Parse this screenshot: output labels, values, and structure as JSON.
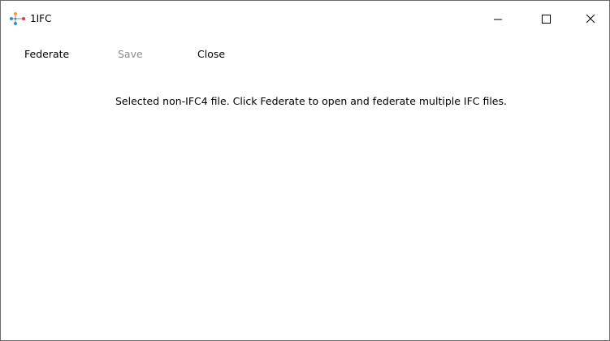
{
  "window": {
    "title": "1IFC",
    "app_icon": "federated-nodes-icon",
    "caption_buttons": {
      "minimize_icon": "minimize-icon",
      "maximize_icon": "maximize-icon",
      "close_icon": "close-icon"
    }
  },
  "menu": {
    "federate_label": "Federate",
    "save_label": "Save",
    "close_label": "Close"
  },
  "main": {
    "status_message": "Selected non-IFC4 file. Click Federate to open and federate multiple IFC files."
  },
  "colors": {
    "disabled_text": "#8c8c8c",
    "icon_node_blue": "#3a86d9",
    "icon_node_red": "#e23b3b",
    "icon_node_orange": "#f2a02c"
  }
}
